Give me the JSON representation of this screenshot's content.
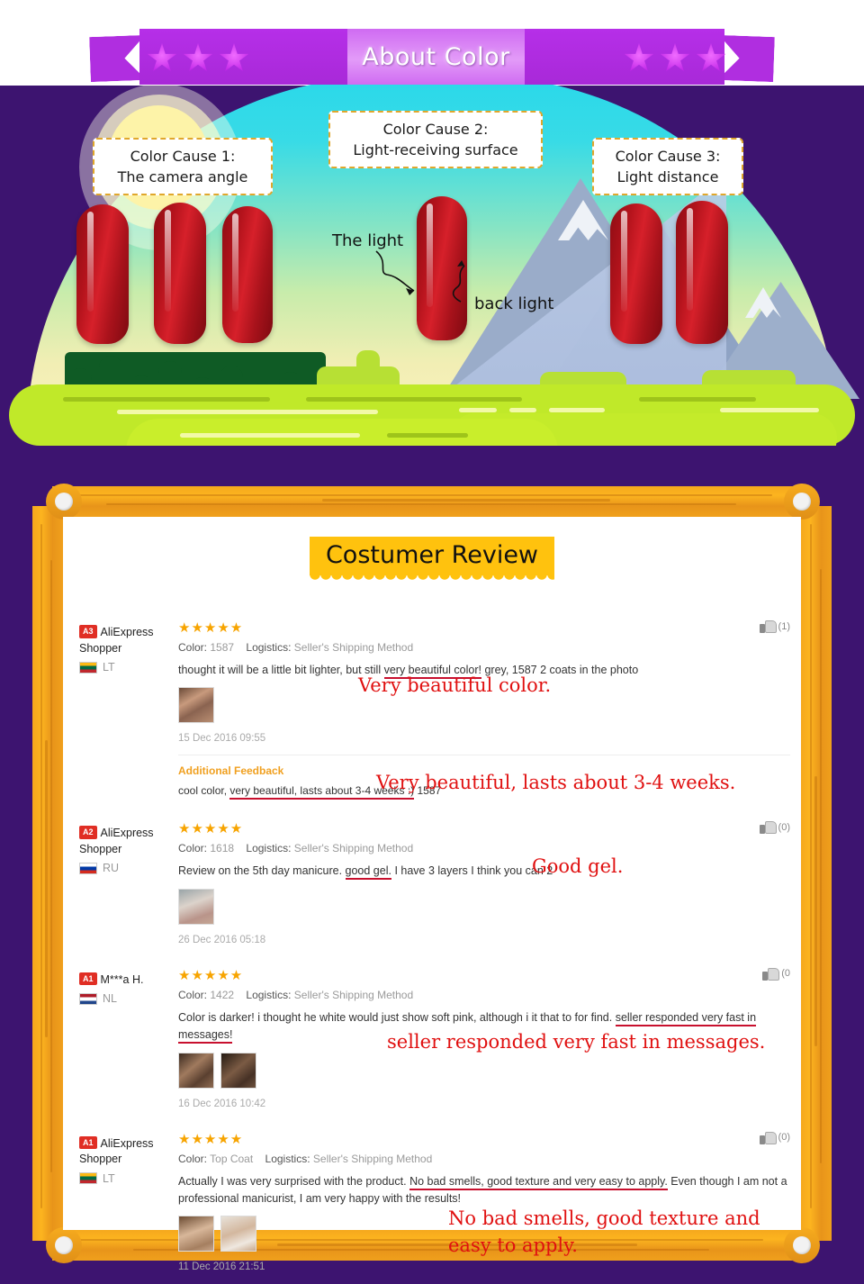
{
  "banner": {
    "title": "About Color",
    "star_count_left": 3,
    "star_count_right": 3,
    "ribbon_color": "#b02ee0",
    "center_color": "#e39bf8"
  },
  "scene": {
    "callouts": [
      {
        "line1": "Color Cause 1:",
        "line2": "The camera angle"
      },
      {
        "line1": "Color Cause 2:",
        "line2": "Light-receiving surface"
      },
      {
        "line1": "Color Cause 3:",
        "line2": "Light distance"
      }
    ],
    "light_label": "The light",
    "backlight_label": "back light",
    "nail_color": "#b4131c",
    "sky_top_color": "#2ad8ea",
    "sky_bottom_color": "#faf3c0",
    "ground_color": "#c0e929",
    "background_purple": "#3d1470"
  },
  "review_panel": {
    "title": "Costumer Review",
    "title_bg": "#ffc20e",
    "frame_color": "#f5a81d",
    "labels": {
      "color": "Color:",
      "logistics": "Logistics:",
      "additional_feedback": "Additional Feedback"
    },
    "reviews": [
      {
        "badge": "A3",
        "user": "AliExpress Shopper",
        "country": "LT",
        "flag_class": "flag-lt",
        "stars": "★★★★★",
        "color_value": "1587",
        "logistics_value": "Seller's Shipping Method",
        "text_before": "thought it will be a little bit lighter, but still ",
        "text_underlined": "very beautiful color!",
        "text_after": " grey, 1587 2 coats in the photo",
        "text_line2": "",
        "thumbs": [
          "t-nail1"
        ],
        "date": "15 Dec 2016 09:55",
        "like_count": "(1)",
        "annotation": "Very beautiful color.",
        "additional_feedback": {
          "title": "Additional Feedback",
          "before": "cool color, ",
          "underlined": "very beautiful, lasts about 3-4 weeks :)",
          "after": " 1587",
          "annotation": "Very beautiful, lasts about 3-4 weeks."
        }
      },
      {
        "badge": "A2",
        "user": "AliExpress Shopper",
        "country": "RU",
        "flag_class": "flag-ru",
        "stars": "★★★★★",
        "color_value": "1618",
        "logistics_value": "Seller's Shipping Method",
        "text_before": "Review on the 5th day manicure. ",
        "text_underlined": "good gel.",
        "text_after": " I have 3 layers I think you can 2",
        "text_line2": "",
        "thumbs": [
          "t-nail2"
        ],
        "date": "26 Dec 2016 05:18",
        "like_count": "(0)",
        "annotation": "Good gel.",
        "additional_feedback": null
      },
      {
        "badge": "A1",
        "user": "M***a H.",
        "country": "NL",
        "flag_class": "flag-nl",
        "stars": "★★★★★",
        "color_value": "1422",
        "logistics_value": "Seller's Shipping Method",
        "text_before": "Color is darker! i thought he white would just show soft pink, although i it that to for find. ",
        "text_underlined": "seller responded very fast in messages!",
        "text_after": "",
        "text_line2": "",
        "thumbs": [
          "t-nail3",
          "t-nail4"
        ],
        "date": "16 Dec 2016 10:42",
        "like_count": "(0",
        "annotation": "seller responded very fast in messages.",
        "additional_feedback": null
      },
      {
        "badge": "A1",
        "user": "AliExpress Shopper",
        "country": "LT",
        "flag_class": "flag-lt",
        "stars": "★★★★★",
        "color_value": "Top Coat",
        "logistics_value": "Seller's Shipping Method",
        "text_before": "Actually I was very surprised with the product. ",
        "text_underlined": "No bad smells, good texture and very easy to apply.",
        "text_after": " Even though I am not a professional manicurist, I am very happy with the results!",
        "text_line2": "",
        "thumbs": [
          "t-nail5",
          "t-nail6"
        ],
        "date": "11 Dec 2016 21:51",
        "like_count": "(0)",
        "annotation": "No bad smells, good texture and\neasy to apply.",
        "additional_feedback": null
      }
    ]
  }
}
